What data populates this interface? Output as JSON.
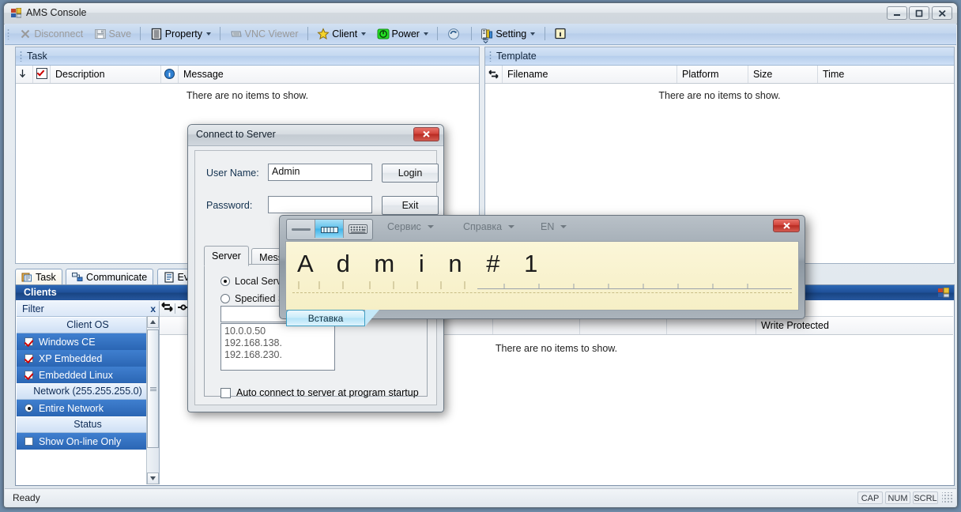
{
  "window": {
    "title": "AMS Console",
    "icon": "app-icon",
    "buttons": {
      "minimize": "Minimize",
      "maximize": "Maximize",
      "close": "Close"
    }
  },
  "toolbar": {
    "items": [
      {
        "label": "Disconnect",
        "icon": "disconnect-icon",
        "disabled": true,
        "dropdown": false
      },
      {
        "label": "Save",
        "icon": "save-icon",
        "disabled": true,
        "dropdown": false
      },
      {
        "label": "Property",
        "icon": "property-icon",
        "disabled": false,
        "dropdown": true
      },
      {
        "label": "VNC Viewer",
        "icon": "vnc-viewer-icon",
        "disabled": true,
        "dropdown": false
      },
      {
        "label": "Client",
        "icon": "client-star-icon",
        "disabled": false,
        "dropdown": true
      },
      {
        "label": "Power",
        "icon": "power-icon",
        "disabled": false,
        "dropdown": true
      },
      {
        "label": "",
        "icon": "refresh-icon",
        "disabled": false,
        "dropdown": false
      },
      {
        "label": "Setting",
        "icon": "setting-icon",
        "disabled": false,
        "dropdown": true
      },
      {
        "label": "",
        "icon": "info-icon",
        "disabled": false,
        "dropdown": false
      }
    ],
    "overflow_label": "Toolbar options"
  },
  "task_pane": {
    "caption": "Task",
    "columns": [
      "",
      "",
      "Description",
      "Message"
    ],
    "empty_message": "There are no items to show."
  },
  "template_pane": {
    "caption": "Template",
    "columns": [
      "Filename",
      "Platform",
      "Size",
      "Time"
    ],
    "empty_message": "There are no items to show."
  },
  "tabstrip": {
    "tabs": [
      {
        "label": "Task",
        "icon": "task-icon",
        "active": true
      },
      {
        "label": "Communicate",
        "icon": "communicate-icon",
        "active": false
      },
      {
        "label": "Event",
        "icon": "event-icon",
        "active": false
      }
    ]
  },
  "clients": {
    "caption": "Clients",
    "caption_icon": "clients-icon",
    "filter": {
      "title": "Filter",
      "close_label": "x",
      "groups": [
        {
          "title": "Client OS",
          "items": [
            {
              "label": "Windows CE",
              "type": "checkbox",
              "checked": true
            },
            {
              "label": "XP Embedded",
              "type": "checkbox",
              "checked": true
            },
            {
              "label": "Embedded Linux",
              "type": "checkbox",
              "checked": true
            }
          ]
        },
        {
          "title": "Network (255.255.255.0)",
          "items": [
            {
              "label": "Entire Network",
              "type": "radio",
              "checked": true
            }
          ]
        },
        {
          "title": "Status",
          "items": [
            {
              "label": "Show On-line Only",
              "type": "checkbox",
              "checked": false
            }
          ]
        }
      ],
      "toolbar_icons": [
        "swap-icon",
        "connect-icon"
      ]
    },
    "grid": {
      "columns": [
        "Write Protected"
      ],
      "empty_message": "There are no items to show."
    }
  },
  "statusbar": {
    "text": "Ready",
    "indicators": [
      "CAP",
      "NUM",
      "SCRL"
    ]
  },
  "dialog_connect": {
    "title": "Connect to Server",
    "close_label": "x",
    "fields": [
      {
        "label": "User Name:",
        "value": "Admin",
        "placeholder": ""
      },
      {
        "label": "Password:",
        "value": "",
        "placeholder": ""
      }
    ],
    "buttons": [
      "Login",
      "Exit"
    ],
    "tabs": [
      {
        "label": "Server",
        "active": true
      },
      {
        "label": "Message",
        "active": false
      }
    ],
    "server_options": [
      {
        "label": "Local Server",
        "checked": true
      },
      {
        "label": "Specified Server",
        "checked": false
      }
    ],
    "server_input_value": "",
    "server_list": [
      "10.0.0.50",
      "192.168.138.",
      "192.168.230."
    ],
    "auto_connect": {
      "label": "Auto connect to server at program startup",
      "checked": false
    }
  },
  "input_panel": {
    "modes": [
      {
        "name": "writing-line-icon",
        "selected": false
      },
      {
        "name": "writing-pad-icon",
        "selected": true
      },
      {
        "name": "onscreen-keyboard-icon",
        "selected": false
      }
    ],
    "menus": [
      {
        "label": "Сервис",
        "dropdown": true
      },
      {
        "label": "Справка",
        "dropdown": true
      },
      {
        "label": "EN",
        "dropdown": true
      }
    ],
    "close_label": "x",
    "ink_text": "A d m i n # 1",
    "insert_button": "Вставка"
  },
  "colors": {
    "accent_blue": "#1e4f98",
    "toolbar_blue": "#c3d6ee",
    "ink_paper": "#faf4d4",
    "close_red": "#d2453c",
    "selection_blue": "#2b66b4",
    "insert_cyan": "#b2e2f7"
  }
}
